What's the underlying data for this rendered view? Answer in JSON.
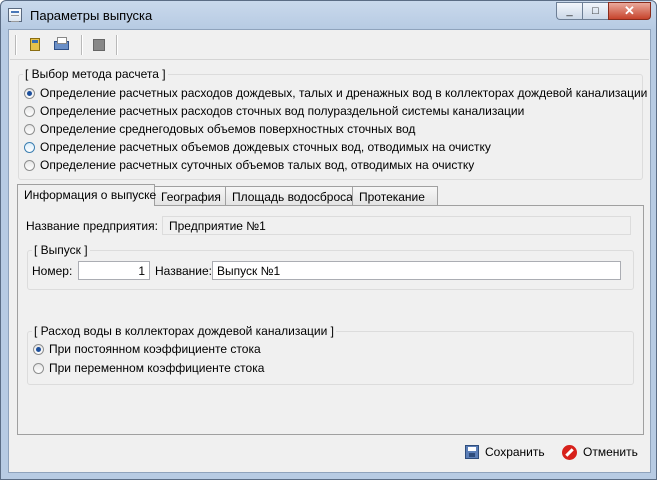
{
  "window": {
    "title": "Параметры выпуска",
    "min_icon": "minimize-icon",
    "max_icon": "maximize-icon",
    "close_icon": "close-icon"
  },
  "toolbar": {
    "buttons": [
      {
        "icon": "calculator-icon"
      },
      {
        "icon": "print-icon"
      },
      {
        "icon": "stop-icon"
      }
    ]
  },
  "method_group": {
    "title": "[ Выбор метода расчета ]",
    "options": [
      {
        "label": "Определение расчетных расходов дождевых, талых и дренажных вод в коллекторах дождевой канализации",
        "checked": true
      },
      {
        "label": "Определение расчетных расходов сточных вод полураздельной системы канализации",
        "checked": false
      },
      {
        "label": "Определение среднегодовых объемов поверхностных сточных вод",
        "checked": false
      },
      {
        "label": "Определение расчетных объемов дождевых сточных вод, отводимых на очистку",
        "checked": false
      },
      {
        "label": "Определение расчетных суточных объемов талых вод, отводимых на очистку",
        "checked": false
      }
    ]
  },
  "tabs": [
    {
      "label": "Информация о выпуске",
      "active": true
    },
    {
      "label": "География",
      "active": false
    },
    {
      "label": "Площадь водосброса",
      "active": false
    },
    {
      "label": "Протекание",
      "active": false
    }
  ],
  "info_tab": {
    "company_label": "Название предприятия:",
    "company_value": "Предприятие №1",
    "release_group": {
      "title": "[ Выпуск ]",
      "number_label": "Номер:",
      "number_value": "1",
      "name_label": "Название:",
      "name_value": "Выпуск №1"
    },
    "flow_group": {
      "title": "[ Расход воды в коллекторах дождевой канализации ]",
      "options": [
        {
          "label": "При постоянном коэффициенте стока",
          "checked": true
        },
        {
          "label": "При переменном коэффициенте стока",
          "checked": false
        }
      ]
    }
  },
  "footer": {
    "save_label": "Сохранить",
    "save_icon": "save-icon",
    "cancel_label": "Отменить",
    "cancel_icon": "cancel-icon"
  }
}
